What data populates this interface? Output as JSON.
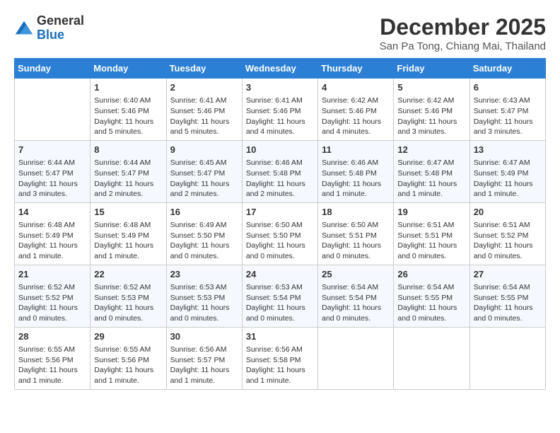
{
  "header": {
    "logo_general": "General",
    "logo_blue": "Blue",
    "month_title": "December 2025",
    "location": "San Pa Tong, Chiang Mai, Thailand"
  },
  "days_of_week": [
    "Sunday",
    "Monday",
    "Tuesday",
    "Wednesday",
    "Thursday",
    "Friday",
    "Saturday"
  ],
  "weeks": [
    [
      {
        "day": "",
        "sunrise": "",
        "sunset": "",
        "daylight": ""
      },
      {
        "day": "1",
        "sunrise": "Sunrise: 6:40 AM",
        "sunset": "Sunset: 5:46 PM",
        "daylight": "Daylight: 11 hours and 5 minutes."
      },
      {
        "day": "2",
        "sunrise": "Sunrise: 6:41 AM",
        "sunset": "Sunset: 5:46 PM",
        "daylight": "Daylight: 11 hours and 5 minutes."
      },
      {
        "day": "3",
        "sunrise": "Sunrise: 6:41 AM",
        "sunset": "Sunset: 5:46 PM",
        "daylight": "Daylight: 11 hours and 4 minutes."
      },
      {
        "day": "4",
        "sunrise": "Sunrise: 6:42 AM",
        "sunset": "Sunset: 5:46 PM",
        "daylight": "Daylight: 11 hours and 4 minutes."
      },
      {
        "day": "5",
        "sunrise": "Sunrise: 6:42 AM",
        "sunset": "Sunset: 5:46 PM",
        "daylight": "Daylight: 11 hours and 3 minutes."
      },
      {
        "day": "6",
        "sunrise": "Sunrise: 6:43 AM",
        "sunset": "Sunset: 5:47 PM",
        "daylight": "Daylight: 11 hours and 3 minutes."
      }
    ],
    [
      {
        "day": "7",
        "sunrise": "Sunrise: 6:44 AM",
        "sunset": "Sunset: 5:47 PM",
        "daylight": "Daylight: 11 hours and 3 minutes."
      },
      {
        "day": "8",
        "sunrise": "Sunrise: 6:44 AM",
        "sunset": "Sunset: 5:47 PM",
        "daylight": "Daylight: 11 hours and 2 minutes."
      },
      {
        "day": "9",
        "sunrise": "Sunrise: 6:45 AM",
        "sunset": "Sunset: 5:47 PM",
        "daylight": "Daylight: 11 hours and 2 minutes."
      },
      {
        "day": "10",
        "sunrise": "Sunrise: 6:46 AM",
        "sunset": "Sunset: 5:48 PM",
        "daylight": "Daylight: 11 hours and 2 minutes."
      },
      {
        "day": "11",
        "sunrise": "Sunrise: 6:46 AM",
        "sunset": "Sunset: 5:48 PM",
        "daylight": "Daylight: 11 hours and 1 minute."
      },
      {
        "day": "12",
        "sunrise": "Sunrise: 6:47 AM",
        "sunset": "Sunset: 5:48 PM",
        "daylight": "Daylight: 11 hours and 1 minute."
      },
      {
        "day": "13",
        "sunrise": "Sunrise: 6:47 AM",
        "sunset": "Sunset: 5:49 PM",
        "daylight": "Daylight: 11 hours and 1 minute."
      }
    ],
    [
      {
        "day": "14",
        "sunrise": "Sunrise: 6:48 AM",
        "sunset": "Sunset: 5:49 PM",
        "daylight": "Daylight: 11 hours and 1 minute."
      },
      {
        "day": "15",
        "sunrise": "Sunrise: 6:48 AM",
        "sunset": "Sunset: 5:49 PM",
        "daylight": "Daylight: 11 hours and 1 minute."
      },
      {
        "day": "16",
        "sunrise": "Sunrise: 6:49 AM",
        "sunset": "Sunset: 5:50 PM",
        "daylight": "Daylight: 11 hours and 0 minutes."
      },
      {
        "day": "17",
        "sunrise": "Sunrise: 6:50 AM",
        "sunset": "Sunset: 5:50 PM",
        "daylight": "Daylight: 11 hours and 0 minutes."
      },
      {
        "day": "18",
        "sunrise": "Sunrise: 6:50 AM",
        "sunset": "Sunset: 5:51 PM",
        "daylight": "Daylight: 11 hours and 0 minutes."
      },
      {
        "day": "19",
        "sunrise": "Sunrise: 6:51 AM",
        "sunset": "Sunset: 5:51 PM",
        "daylight": "Daylight: 11 hours and 0 minutes."
      },
      {
        "day": "20",
        "sunrise": "Sunrise: 6:51 AM",
        "sunset": "Sunset: 5:52 PM",
        "daylight": "Daylight: 11 hours and 0 minutes."
      }
    ],
    [
      {
        "day": "21",
        "sunrise": "Sunrise: 6:52 AM",
        "sunset": "Sunset: 5:52 PM",
        "daylight": "Daylight: 11 hours and 0 minutes."
      },
      {
        "day": "22",
        "sunrise": "Sunrise: 6:52 AM",
        "sunset": "Sunset: 5:53 PM",
        "daylight": "Daylight: 11 hours and 0 minutes."
      },
      {
        "day": "23",
        "sunrise": "Sunrise: 6:53 AM",
        "sunset": "Sunset: 5:53 PM",
        "daylight": "Daylight: 11 hours and 0 minutes."
      },
      {
        "day": "24",
        "sunrise": "Sunrise: 6:53 AM",
        "sunset": "Sunset: 5:54 PM",
        "daylight": "Daylight: 11 hours and 0 minutes."
      },
      {
        "day": "25",
        "sunrise": "Sunrise: 6:54 AM",
        "sunset": "Sunset: 5:54 PM",
        "daylight": "Daylight: 11 hours and 0 minutes."
      },
      {
        "day": "26",
        "sunrise": "Sunrise: 6:54 AM",
        "sunset": "Sunset: 5:55 PM",
        "daylight": "Daylight: 11 hours and 0 minutes."
      },
      {
        "day": "27",
        "sunrise": "Sunrise: 6:54 AM",
        "sunset": "Sunset: 5:55 PM",
        "daylight": "Daylight: 11 hours and 0 minutes."
      }
    ],
    [
      {
        "day": "28",
        "sunrise": "Sunrise: 6:55 AM",
        "sunset": "Sunset: 5:56 PM",
        "daylight": "Daylight: 11 hours and 1 minute."
      },
      {
        "day": "29",
        "sunrise": "Sunrise: 6:55 AM",
        "sunset": "Sunset: 5:56 PM",
        "daylight": "Daylight: 11 hours and 1 minute."
      },
      {
        "day": "30",
        "sunrise": "Sunrise: 6:56 AM",
        "sunset": "Sunset: 5:57 PM",
        "daylight": "Daylight: 11 hours and 1 minute."
      },
      {
        "day": "31",
        "sunrise": "Sunrise: 6:56 AM",
        "sunset": "Sunset: 5:58 PM",
        "daylight": "Daylight: 11 hours and 1 minute."
      },
      {
        "day": "",
        "sunrise": "",
        "sunset": "",
        "daylight": ""
      },
      {
        "day": "",
        "sunrise": "",
        "sunset": "",
        "daylight": ""
      },
      {
        "day": "",
        "sunrise": "",
        "sunset": "",
        "daylight": ""
      }
    ]
  ]
}
